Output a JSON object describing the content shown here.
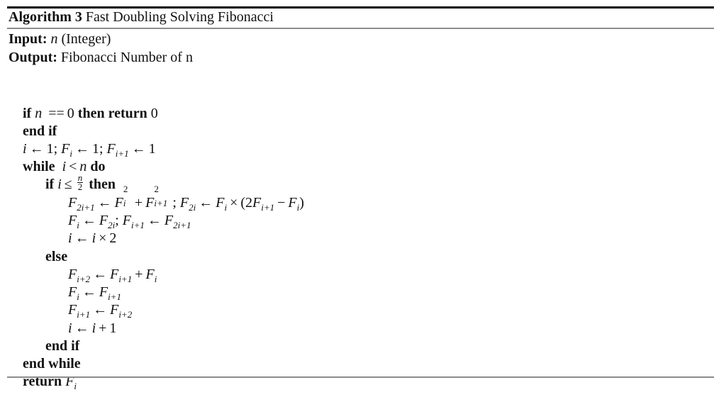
{
  "algorithm": {
    "label": "Algorithm 3",
    "title": "Fast Doubling Solving Fibonacci",
    "input_label": "Input:",
    "input_var": "n",
    "input_desc": "(Integer)",
    "output_label": "Output:",
    "output_desc": "Fibonacci Number of n"
  },
  "keywords": {
    "if": "if",
    "then": "then",
    "return": "return",
    "end_if": "end if",
    "while": "while",
    "do": "do",
    "else": "else",
    "end_while": "end while"
  },
  "lines": {
    "l1": {
      "var": "n",
      "op": "==",
      "val": "0",
      "ret": "0"
    },
    "l3": {
      "i": "i",
      "arrow": "←",
      "one": "1",
      "semi": ";",
      "F": "F",
      "sub_i": "i",
      "sub_i1": "i+1"
    },
    "l4": {
      "cond_i": "i",
      "lt": "<",
      "cond_n": "n"
    },
    "l5": {
      "i": "i",
      "le": "≤",
      "num": "n",
      "den": "2"
    },
    "l6": {
      "lhs_sub": "2i+1",
      "sup": "2",
      "sub_i": "i",
      "sub_i1": "i+1",
      "plus": "+",
      "lhs2_sub": "2i",
      "times": "×",
      "paren_open": "(2",
      "minus": "−",
      "paren_close": ")"
    },
    "l7": {
      "sub_i": "i",
      "sub_2i": "2i",
      "sub_i1": "i+1",
      "sub_2i1": "2i+1"
    },
    "l8": {
      "i": "i",
      "times": "×",
      "two": "2"
    },
    "l10": {
      "sub_i2": "i+2",
      "sub_i1": "i+1",
      "sub_i": "i",
      "plus": "+"
    },
    "l11": {
      "sub_i": "i",
      "sub_i1": "i+1"
    },
    "l12": {
      "sub_i1": "i+1",
      "sub_i2": "i+2"
    },
    "l13": {
      "i": "i",
      "plus": "+",
      "one": "1"
    },
    "l16": {
      "F": "F",
      "sub_i": "i"
    }
  }
}
